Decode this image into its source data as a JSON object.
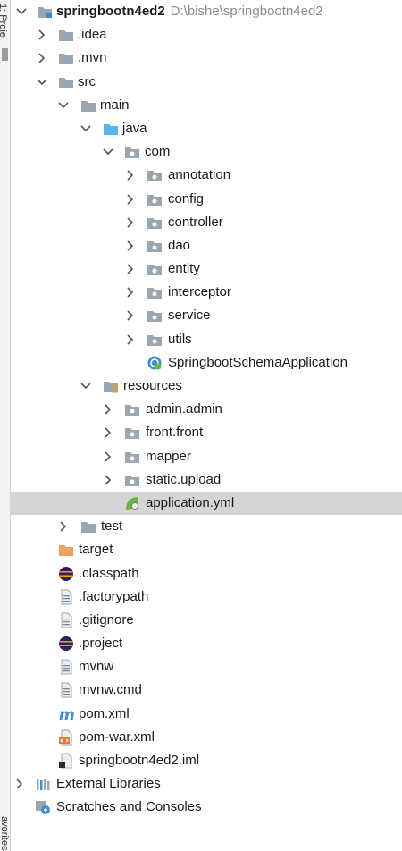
{
  "left_strip": {
    "top_text": "1: Proje",
    "bottom_text": "avorites"
  },
  "tree": {
    "root": {
      "name": "springbootn4ed2",
      "path": "D:\\bishe\\springbootn4ed2"
    },
    "idea": ".idea",
    "mvn": ".mvn",
    "src": "src",
    "main": "main",
    "java": "java",
    "com": "com",
    "packages": [
      "annotation",
      "config",
      "controller",
      "dao",
      "entity",
      "interceptor",
      "service",
      "utils"
    ],
    "app_class": "SpringbootSchemaApplication",
    "resources": "resources",
    "res_dirs": [
      "admin.admin",
      "front.front",
      "mapper",
      "static.upload"
    ],
    "app_yml": "application.yml",
    "test": "test",
    "target": "target",
    "files": [
      ".classpath",
      ".factorypath",
      ".gitignore",
      ".project",
      "mvnw",
      "mvnw.cmd",
      "pom.xml",
      "pom-war.xml",
      "springbootn4ed2.iml"
    ],
    "ext_libs": "External Libraries",
    "scratches": "Scratches and Consoles"
  }
}
